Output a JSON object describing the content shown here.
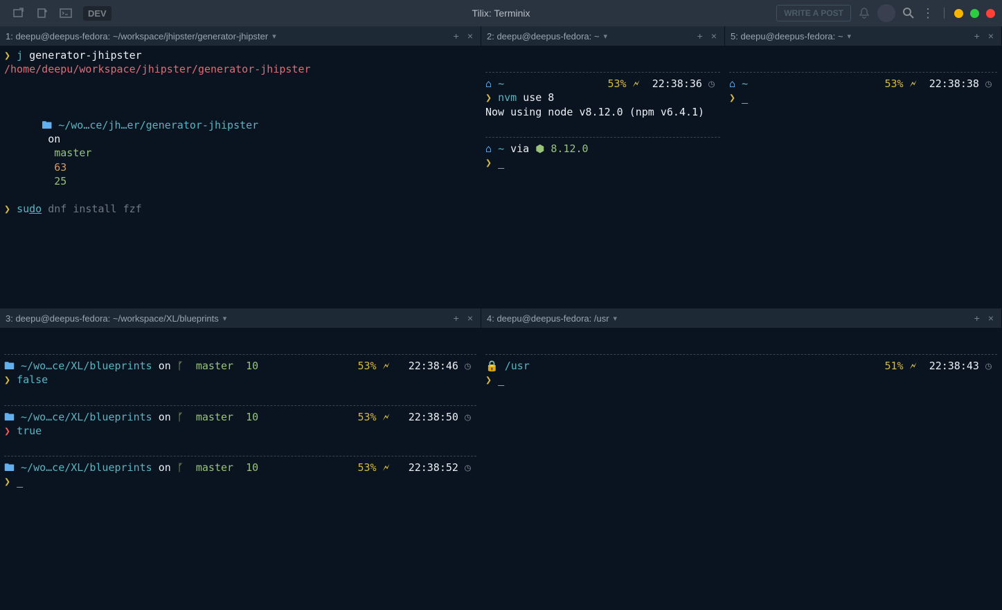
{
  "window": {
    "title": "Tilix: Terminix",
    "write_post": "WRITE A POST",
    "dev": "DEV"
  },
  "panes": {
    "p1": {
      "tab": "1: deepu@deepus-fedora: ~/workspace/jhipster/generator-jhipster",
      "cmd1_prompt": "❯",
      "cmd1": "j generator-jhipster",
      "cmd1_j": "j",
      "cmd1_arg": "generator-jhipster",
      "out1": "/home/deepu/workspace/jhipster/generator-jhipster",
      "path": "~/wo…ce/jh…er/generator-jhipster",
      "on": "on",
      "branch": "master",
      "n1": "63",
      "n2": "25",
      "cmd2_sudo_su": "su",
      "cmd2_sudo_do": "do",
      "cmd2_rest": "dnf install fzf"
    },
    "p2": {
      "tab": "2: deepu@deepus-fedora: ~",
      "tilde": "~",
      "pct": "53%",
      "time": "22:38:36",
      "cmd": "nvm use 8",
      "cmd_nvm": "nvm",
      "cmd_args": "use 8",
      "out": "Now using node v8.12.0 (npm v6.4.1)",
      "via": "via",
      "node": "8.12.0"
    },
    "p5": {
      "tab": "5: deepu@deepus-fedora: ~",
      "tilde": "~",
      "pct": "53%",
      "time": "22:38:38"
    },
    "p3": {
      "tab": "3: deepu@deepus-fedora: ~/workspace/XL/blueprints",
      "path": "~/wo…ce/XL/blueprints",
      "on": "on",
      "branch": "master",
      "stash": "10",
      "rows": [
        {
          "pct": "53%",
          "time": "22:38:46",
          "cmd": "false",
          "err": true
        },
        {
          "pct": "53%",
          "time": "22:38:50",
          "cmd": "true",
          "err": false
        },
        {
          "pct": "53%",
          "time": "22:38:52",
          "cmd": "",
          "err": false
        }
      ]
    },
    "p4": {
      "tab": "4: deepu@deepus-fedora: /usr",
      "path": "/usr",
      "pct": "51%",
      "time": "22:38:43"
    }
  }
}
